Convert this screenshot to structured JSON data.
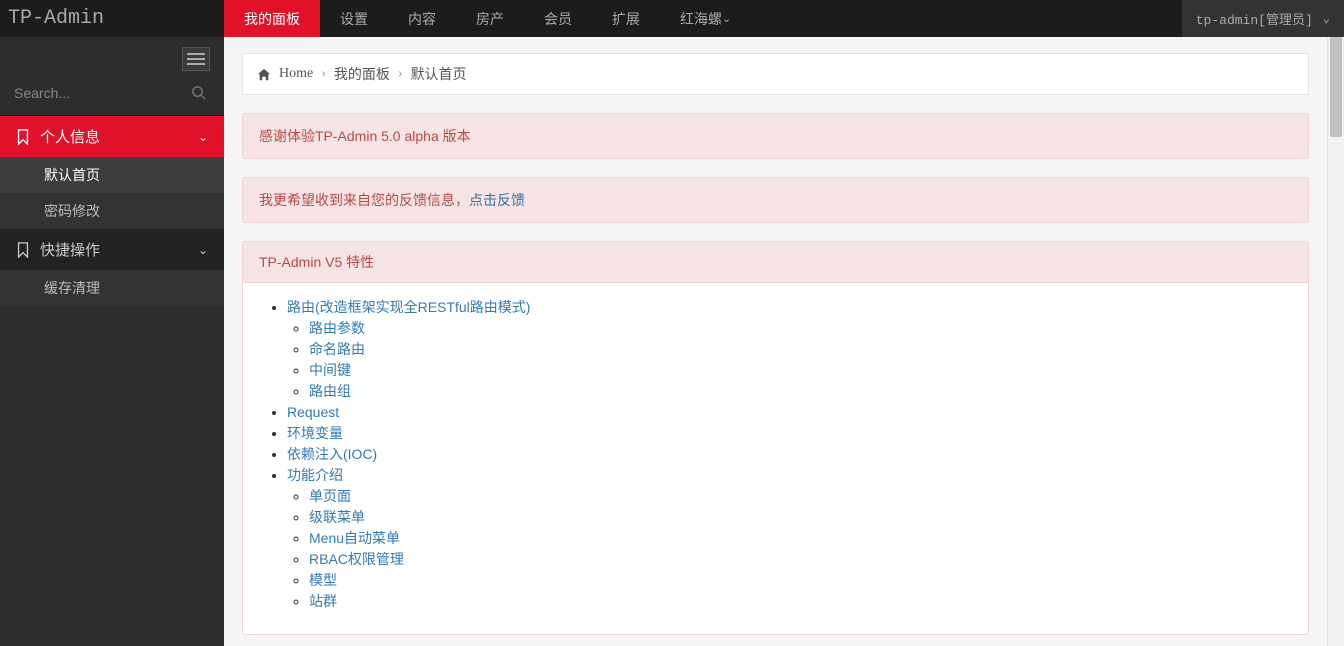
{
  "brand": "TP-Admin",
  "topnav": [
    "我的面板",
    "设置",
    "内容",
    "房产",
    "会员",
    "扩展",
    "红海螺"
  ],
  "topnav_active": 0,
  "user_label": "tp-admin[管理员]",
  "search": {
    "placeholder": "Search..."
  },
  "sidebar": {
    "sections": [
      {
        "label": "个人信息",
        "active": true,
        "items": [
          "默认首页",
          "密码修改"
        ],
        "active_item": 0
      },
      {
        "label": "快捷操作",
        "active": false,
        "items": [
          "缓存清理"
        ],
        "active_item": -1
      }
    ]
  },
  "breadcrumb": {
    "home": "Home",
    "items": [
      "我的面板",
      "默认首页"
    ]
  },
  "alerts": [
    {
      "text": "感谢体验TP-Admin 5.0 alpha 版本"
    },
    {
      "text": "我更希望收到来自您的反馈信息，",
      "link_text": "点击反馈"
    }
  ],
  "panel": {
    "title": "TP-Admin V5 特性",
    "items": [
      {
        "label": "路由(改造框架实现全RESTful路由模式)",
        "children": [
          "路由参数",
          "命名路由",
          "中间键",
          "路由组"
        ]
      },
      {
        "label": "Request"
      },
      {
        "label": "环境变量"
      },
      {
        "label": "依赖注入(IOC)"
      },
      {
        "label": "功能介绍",
        "children": [
          "单页面",
          "级联菜单",
          "Menu自动菜单",
          "RBAC权限管理",
          "模型",
          "站群"
        ]
      }
    ]
  }
}
